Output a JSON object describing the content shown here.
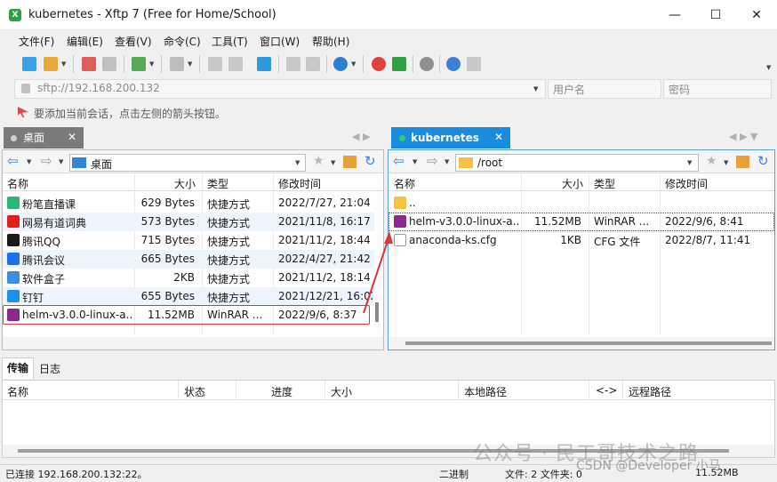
{
  "window": {
    "title": "kubernetes - Xftp 7 (Free for Home/School)",
    "minimize": "—",
    "maximize": "☐",
    "close": "✕"
  },
  "menu": [
    "文件(F)",
    "编辑(E)",
    "查看(V)",
    "命令(C)",
    "工具(T)",
    "窗口(W)",
    "帮助(H)"
  ],
  "address": {
    "value": "sftp://192.168.200.132",
    "user_placeholder": "用户名",
    "pass_placeholder": "密码"
  },
  "hint": "要添加当前会话，点击左侧的箭头按钮。",
  "tabs": {
    "local": "桌面",
    "remote": "kubernetes"
  },
  "local": {
    "path": "桌面",
    "headers": [
      "名称",
      "大小",
      "类型",
      "修改时间"
    ],
    "rows": [
      {
        "name": "粉笔直播课",
        "size": "629 Bytes",
        "type": "快捷方式",
        "mtime": "2022/7/27, 21:04",
        "icon": "app-icon",
        "color": "#2bb673"
      },
      {
        "name": "网易有道词典",
        "size": "573 Bytes",
        "type": "快捷方式",
        "mtime": "2021/11/8, 16:17",
        "icon": "app-icon",
        "color": "#e02020"
      },
      {
        "name": "腾讯QQ",
        "size": "715 Bytes",
        "type": "快捷方式",
        "mtime": "2021/11/2, 18:44",
        "icon": "penguin-icon",
        "color": "#1a1a1a"
      },
      {
        "name": "腾讯会议",
        "size": "665 Bytes",
        "type": "快捷方式",
        "mtime": "2022/4/27, 21:42",
        "icon": "app-icon",
        "color": "#1e6ff0"
      },
      {
        "name": "软件盒子",
        "size": "2KB",
        "type": "快捷方式",
        "mtime": "2021/11/2, 18:14",
        "icon": "box-icon",
        "color": "#3a8de0"
      },
      {
        "name": "钉钉",
        "size": "655 Bytes",
        "type": "快捷方式",
        "mtime": "2021/12/21, 16:02",
        "icon": "app-icon",
        "color": "#1f8ef1"
      },
      {
        "name": "helm-v3.0.0-linux-a...",
        "size": "11.52MB",
        "type": "WinRAR ...",
        "mtime": "2022/9/6, 8:37",
        "icon": "winrar-icon",
        "color": "#8a2a8a"
      }
    ]
  },
  "remote": {
    "path": "/root",
    "headers": [
      "名称",
      "大小",
      "类型",
      "修改时间"
    ],
    "rows": [
      {
        "name": "..",
        "size": "",
        "type": "",
        "mtime": "",
        "icon": "folder-icon",
        "color": "#f5c242"
      },
      {
        "name": "helm-v3.0.0-linux-a...",
        "size": "11.52MB",
        "type": "WinRAR ...",
        "mtime": "2022/9/6, 8:41",
        "icon": "winrar-icon",
        "color": "#8a2a8a"
      },
      {
        "name": "anaconda-ks.cfg",
        "size": "1KB",
        "type": "CFG 文件",
        "mtime": "2022/8/7, 11:41",
        "icon": "file-icon",
        "color": "#ffffff"
      }
    ]
  },
  "bottom": {
    "tabs": [
      "传输",
      "日志"
    ],
    "headers": [
      "名称",
      "状态",
      "进度",
      "大小",
      "本地路径",
      "<->",
      "远程路径"
    ]
  },
  "status": {
    "connection": "已连接 192.168.200.132:22。",
    "mode": "二进制",
    "files": "文件: 2  文件夹: 0",
    "size": "11.52MB"
  },
  "watermark": "公众号 · 民工哥技术之路",
  "csdn": "CSDN @Developer 小马"
}
